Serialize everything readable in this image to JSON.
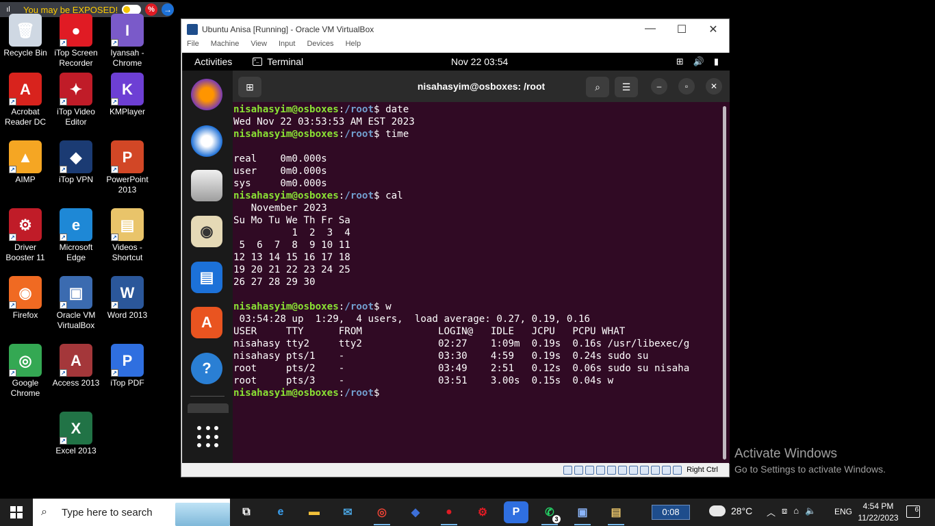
{
  "banner": {
    "text": "You may be EXPOSED!",
    "badge": "%",
    "arrow": "→"
  },
  "desktop_icons": [
    {
      "label": "Recycle Bin",
      "glyph": "🗑",
      "color": "#cfd8e3"
    },
    {
      "label": "iTop Screen Recorder",
      "glyph": "●",
      "color": "#e01b24"
    },
    {
      "label": "Iyansah - Chrome",
      "glyph": "I",
      "color": "#7a5ac9"
    },
    {
      "label": "Acrobat Reader DC",
      "glyph": "A",
      "color": "#d8231d"
    },
    {
      "label": "iTop Video Editor",
      "glyph": "✦",
      "color": "#c01c28"
    },
    {
      "label": "KMPlayer",
      "glyph": "K",
      "color": "#6d3fd4"
    },
    {
      "label": "AIMP",
      "glyph": "▲",
      "color": "#f5a623"
    },
    {
      "label": "iTop VPN",
      "glyph": "◆",
      "color": "#1b3b73"
    },
    {
      "label": "PowerPoint 2013",
      "glyph": "P",
      "color": "#d24726"
    },
    {
      "label": "Driver Booster 11",
      "glyph": "⚙",
      "color": "#c01c28"
    },
    {
      "label": "Microsoft Edge",
      "glyph": "e",
      "color": "#1e88d6"
    },
    {
      "label": "Videos - Shortcut",
      "glyph": "▤",
      "color": "#e9c46a"
    },
    {
      "label": "Firefox",
      "glyph": "◉",
      "color": "#f06a22"
    },
    {
      "label": "Oracle VM VirtualBox",
      "glyph": "▣",
      "color": "#3b6bb0"
    },
    {
      "label": "Word 2013",
      "glyph": "W",
      "color": "#2b579a"
    },
    {
      "label": "Google Chrome",
      "glyph": "◎",
      "color": "#34a853"
    },
    {
      "label": "Access 2013",
      "glyph": "A",
      "color": "#a4373a"
    },
    {
      "label": "iTop PDF",
      "glyph": "P",
      "color": "#2f6fe0"
    },
    {
      "label": "Excel 2013",
      "glyph": "X",
      "color": "#217346"
    }
  ],
  "vbox": {
    "title": "Ubuntu Anisa [Running] - Oracle VM VirtualBox",
    "menu": [
      "File",
      "Machine",
      "View",
      "Input",
      "Devices",
      "Help"
    ],
    "status_key": "Right Ctrl"
  },
  "gnome": {
    "activities": "Activities",
    "app": "Terminal",
    "clock": "Nov 22  03:54"
  },
  "terminal": {
    "title": "nisahasyim@osboxes: /root",
    "prompt_user": "nisahasyim@osboxes",
    "prompt_sep": ":",
    "prompt_path": "/root",
    "prompt_end": "$",
    "lines": [
      {
        "type": "cmd",
        "text": " date"
      },
      {
        "type": "out",
        "text": "Wed Nov 22 03:53:53 AM EST 2023"
      },
      {
        "type": "cmd",
        "text": " time"
      },
      {
        "type": "out",
        "text": ""
      },
      {
        "type": "out",
        "text": "real    0m0.000s"
      },
      {
        "type": "out",
        "text": "user    0m0.000s"
      },
      {
        "type": "out",
        "text": "sys     0m0.000s"
      },
      {
        "type": "cmd",
        "text": " cal"
      },
      {
        "type": "out",
        "text": "   November 2023"
      },
      {
        "type": "out",
        "text": "Su Mo Tu We Th Fr Sa"
      },
      {
        "type": "out",
        "text": "          1  2  3  4"
      },
      {
        "type": "out",
        "text": " 5  6  7  8  9 10 11"
      },
      {
        "type": "out",
        "text": "12 13 14 15 16 17 18"
      },
      {
        "type": "out",
        "text": "19 20 21 22 23 24 25"
      },
      {
        "type": "out",
        "text": "26 27 28 29 30"
      },
      {
        "type": "out",
        "text": ""
      },
      {
        "type": "cmd",
        "text": " w"
      },
      {
        "type": "out",
        "text": " 03:54:28 up  1:29,  4 users,  load average: 0.27, 0.19, 0.16"
      },
      {
        "type": "out",
        "text": "USER     TTY      FROM             LOGIN@   IDLE   JCPU   PCPU WHAT"
      },
      {
        "type": "out",
        "text": "nisahasy tty2     tty2             02:27    1:09m  0.19s  0.16s /usr/libexec/g"
      },
      {
        "type": "out",
        "text": "nisahasy pts/1    -                03:30    4:59   0.19s  0.24s sudo su"
      },
      {
        "type": "out",
        "text": "root     pts/2    -                03:49    2:51   0.12s  0.06s sudo su nisaha"
      },
      {
        "type": "out",
        "text": "root     pts/3    -                03:51    3.00s  0.15s  0.04s w"
      },
      {
        "type": "cmd",
        "text": ""
      }
    ]
  },
  "watermark": {
    "line1": "Activate Windows",
    "line2": "Go to Settings to activate Windows."
  },
  "taskbar": {
    "search_placeholder": "Type here to search",
    "timer": "0:08",
    "temperature": "28°C",
    "lang": "ENG",
    "time": "4:54 PM",
    "date": "11/22/2023",
    "notifications": "6",
    "whatsapp_badge": "3"
  }
}
